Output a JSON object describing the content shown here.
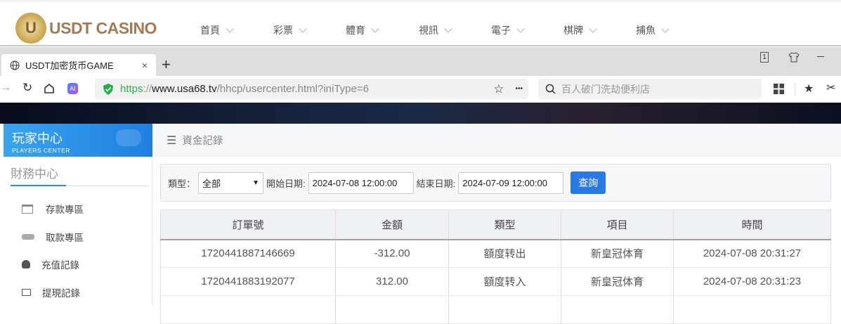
{
  "site": {
    "logo_text": "USDT CASINO",
    "logo_letter": "U",
    "nav": [
      "首頁",
      "彩票",
      "體育",
      "視訊",
      "電子",
      "棋牌",
      "捕魚"
    ]
  },
  "browser": {
    "tab_title": "USDT加密货币GAME",
    "tab_close": "×",
    "new_tab": "+",
    "tab_count": "1",
    "url_scheme": "https",
    "url_sep": "://",
    "url_host": "www.usa68.tv",
    "url_path": "/hhcp/usercenter.html?iniType=6",
    "search_placeholder": "百人破门洗劫便利店",
    "ai_label": "AI",
    "more": "•••"
  },
  "sidebar": {
    "title": "玩家中心",
    "subtitle": "PLAYERS CENTER",
    "section": "財務中心",
    "items": [
      {
        "label": "存款專區",
        "icon": "card-icon"
      },
      {
        "label": "取款專區",
        "icon": "hand-money-icon"
      },
      {
        "label": "充值記錄",
        "icon": "money-bag-icon"
      },
      {
        "label": "提現記錄",
        "icon": "wallet-icon"
      }
    ],
    "accent": "#2a8ae6"
  },
  "main": {
    "title": "資金記錄",
    "filter": {
      "type_label": "類型：",
      "type_value": "全部",
      "start_label": "開始日期:",
      "start_value": "2024-07-08 12:00:00",
      "end_label": "結束日期:",
      "end_value": "2024-07-09 12:00:00",
      "query": "查詢"
    },
    "table": {
      "headers": [
        "訂單號",
        "金額",
        "類型",
        "項目",
        "時間"
      ],
      "rows": [
        [
          "1720441887146669",
          "-312.00",
          "額度转出",
          "新皇冠体育",
          "2024-07-08 20:31:27"
        ],
        [
          "1720441883192077",
          "312.00",
          "額度转入",
          "新皇冠体育",
          "2024-07-08 20:31:23"
        ]
      ]
    }
  }
}
